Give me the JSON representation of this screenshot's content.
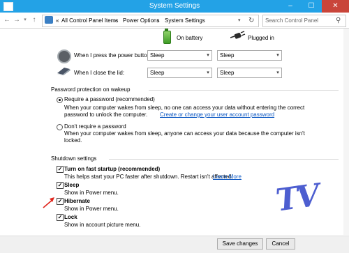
{
  "window": {
    "title": "System Settings",
    "minimize": "–",
    "maximize": "☐",
    "close": "✕"
  },
  "nav": {
    "back": "←",
    "forward": "→",
    "up": "↑",
    "breadcrumb_prefix": "«",
    "breadcrumb": [
      "All Control Panel Items",
      "Power Options",
      "System Settings"
    ],
    "separator": "›",
    "dropdown": "▾",
    "refresh": "↻",
    "search_placeholder": "Search Control Panel",
    "search_icon": "⚲"
  },
  "power": {
    "col_battery": "On battery",
    "col_plugged": "Plugged in",
    "rows": [
      {
        "label": "When I press the power button:",
        "battery": "Sleep",
        "plugged": "Sleep"
      },
      {
        "label": "When I close the lid:",
        "battery": "Sleep",
        "plugged": "Sleep"
      }
    ]
  },
  "password": {
    "heading": "Password protection on wakeup",
    "require_label": "Require a password (recommended)",
    "require_desc1": "When your computer wakes from sleep, no one can access your data without entering the correct",
    "require_desc2": "password to unlock the computer.",
    "require_link": "Create or change your user account password",
    "norequire_label": "Don't require a password",
    "norequire_desc1": "When your computer wakes from sleep, anyone can access your data because the computer isn't",
    "norequire_desc2": "locked.",
    "selected": "require"
  },
  "shutdown": {
    "heading": "Shutdown settings",
    "items": [
      {
        "label": "Turn on fast startup (recommended)",
        "desc": "This helps start your PC faster after shutdown. Restart isn't affected.",
        "link": "Learn More",
        "checked": true
      },
      {
        "label": "Sleep",
        "desc": "Show in Power menu.",
        "checked": true
      },
      {
        "label": "Hibernate",
        "desc": "Show in Power menu.",
        "checked": true
      },
      {
        "label": "Lock",
        "desc": "Show in account picture menu.",
        "checked": true
      }
    ],
    "check_glyph": "✓"
  },
  "watermark": "TV",
  "buttons": {
    "save": "Save changes",
    "cancel": "Cancel"
  },
  "colors": {
    "titlebar": "#23a2e6",
    "link": "#0a56c2",
    "arrow": "#e0241b",
    "watermark": "#2f43c8"
  }
}
